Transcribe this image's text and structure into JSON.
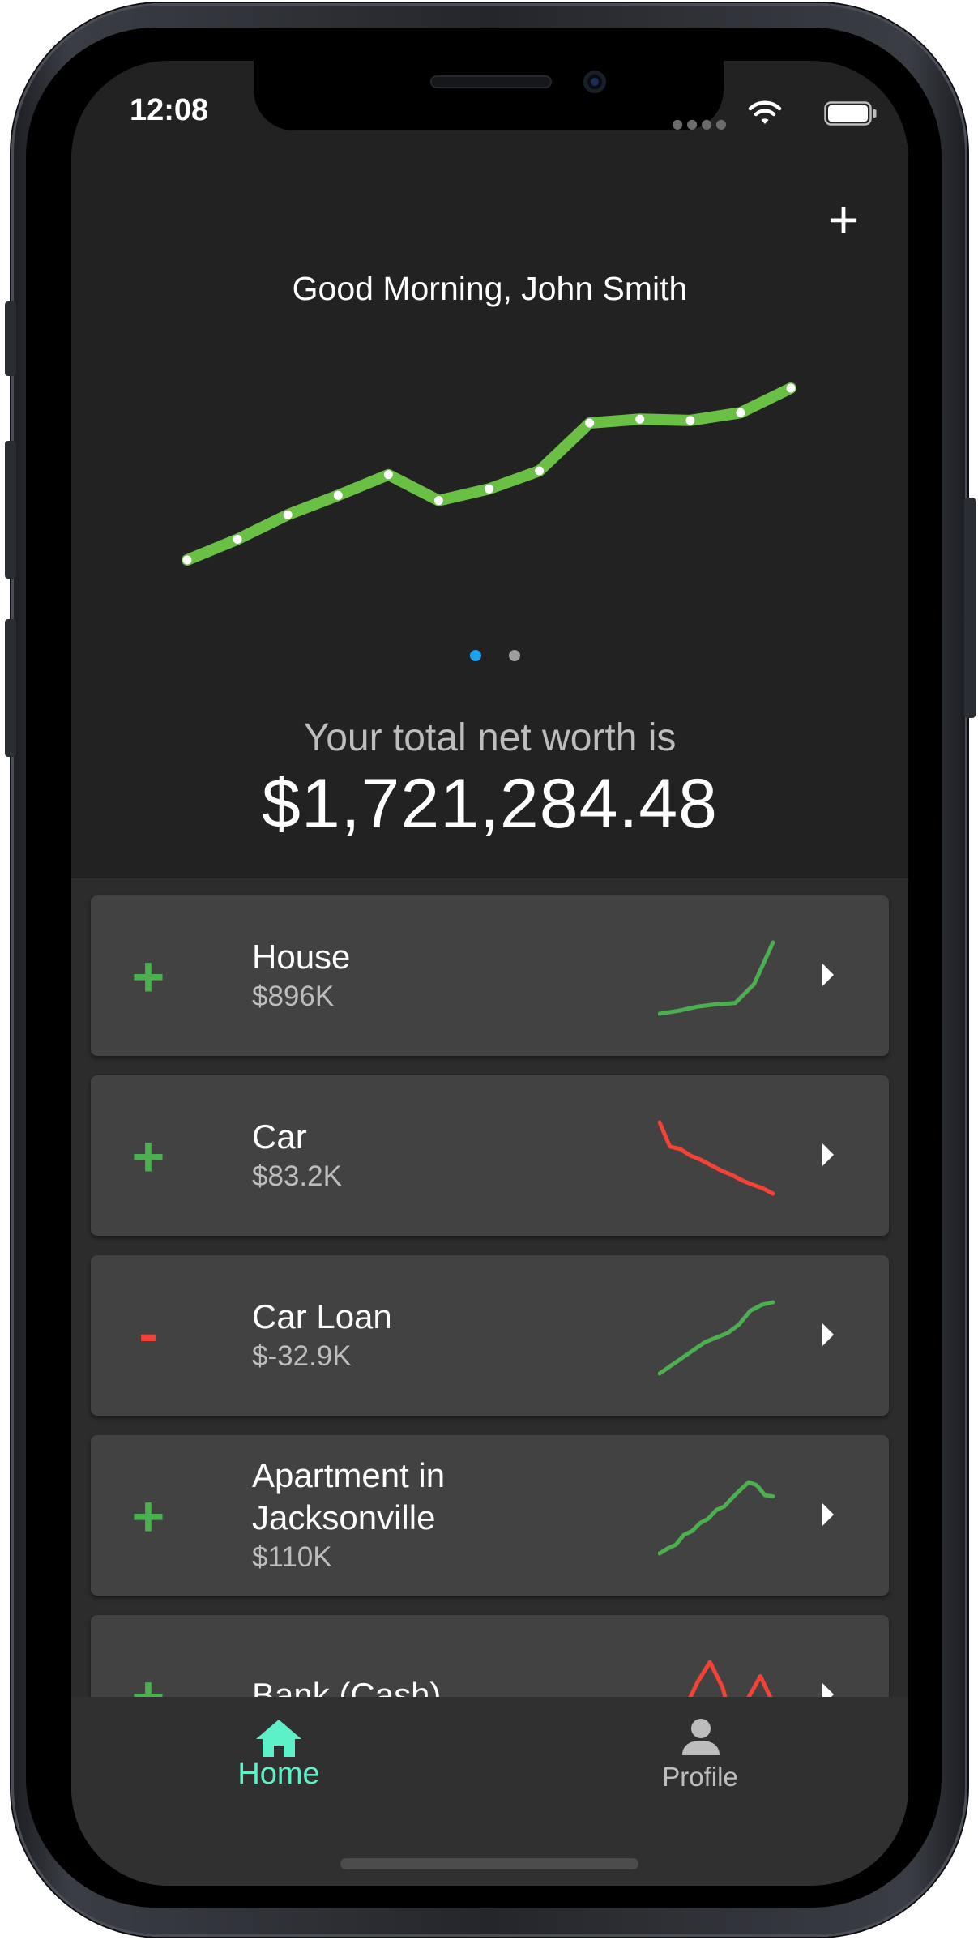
{
  "status_bar": {
    "time": "12:08"
  },
  "header": {
    "greeting": "Good Morning, John Smith",
    "add_label": "+"
  },
  "colors": {
    "background": "#222222",
    "card": "#424242",
    "positive": "#4caf50",
    "negative": "#f44336",
    "main_line": "#6abf45",
    "active_dot": "#1fa0ec",
    "inactive_dot": "#9e9e9e",
    "nav_active": "#5ef0c8",
    "nav_inactive": "#bdbdbd"
  },
  "chart_data": {
    "type": "line",
    "series": [
      {
        "values": [
          0,
          1.6,
          3.5,
          5.0,
          6.6,
          4.6,
          5.5,
          6.9,
          10.6,
          10.9,
          10.8,
          11.4,
          13.3
        ]
      }
    ],
    "title": "",
    "xlabel": "",
    "ylabel": "",
    "grid": false
  },
  "pager": {
    "count": 2,
    "active": 0
  },
  "summary": {
    "label": "Your total net worth is",
    "value": "$1,721,284.48"
  },
  "assets": [
    {
      "name": "House",
      "value": "$896K",
      "sign": "+",
      "trend": "up",
      "spark": [
        0,
        0.5,
        1.2,
        1.6,
        1.8,
        5,
        12
      ]
    },
    {
      "name": "Car",
      "value": "$83.2K",
      "sign": "+",
      "trend": "down",
      "spark": [
        12,
        8,
        7.6,
        6.5,
        5.8,
        4.9,
        4,
        3.3,
        2.4,
        1.7,
        1.1,
        0.2
      ]
    },
    {
      "name": "Car Loan",
      "value": "$-32.9K",
      "sign": "-",
      "trend": "up",
      "spark": [
        0,
        1.2,
        2.4,
        3.6,
        4.8,
        5.5,
        6.2,
        7.5,
        9.6,
        10.5,
        10.9
      ]
    },
    {
      "name": "Apartment in Jacksonville",
      "value": "$110K",
      "sign": "+",
      "trend": "up",
      "spark": [
        0,
        0.8,
        1.4,
        3,
        3.6,
        4.9,
        5.6,
        7,
        7.6,
        9,
        10.3,
        11.5,
        11,
        9.4,
        9.2
      ]
    },
    {
      "name": "Bank (Cash)",
      "value": "",
      "sign": "+",
      "trend": "volatile",
      "spark": [
        4,
        4.5,
        5.2,
        7.8,
        9.8,
        7.3,
        2.8,
        6.2,
        8.4,
        5.8
      ]
    }
  ],
  "bottom_nav": {
    "items": [
      {
        "label": "Home",
        "icon": "home-icon",
        "active": true
      },
      {
        "label": "Profile",
        "icon": "person-icon",
        "active": false
      }
    ]
  }
}
